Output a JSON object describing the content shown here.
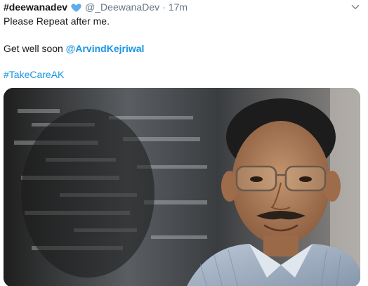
{
  "tweet": {
    "display_name": "#deewanadev",
    "handle": "@_DeewanaDev",
    "separator": "·",
    "time": "17m",
    "line1": "Please Repeat after me.",
    "line2_prefix": "Get well soon ",
    "mention": "@ArvindKejriwal",
    "hashtag": "#TakeCareAK"
  },
  "icons": {
    "verified": "blue-heart-icon",
    "menu": "chevron-down-icon",
    "media": "photo"
  },
  "colors": {
    "link": "#1b95e0",
    "secondary_text": "#657786",
    "heart": "#5dadec"
  }
}
